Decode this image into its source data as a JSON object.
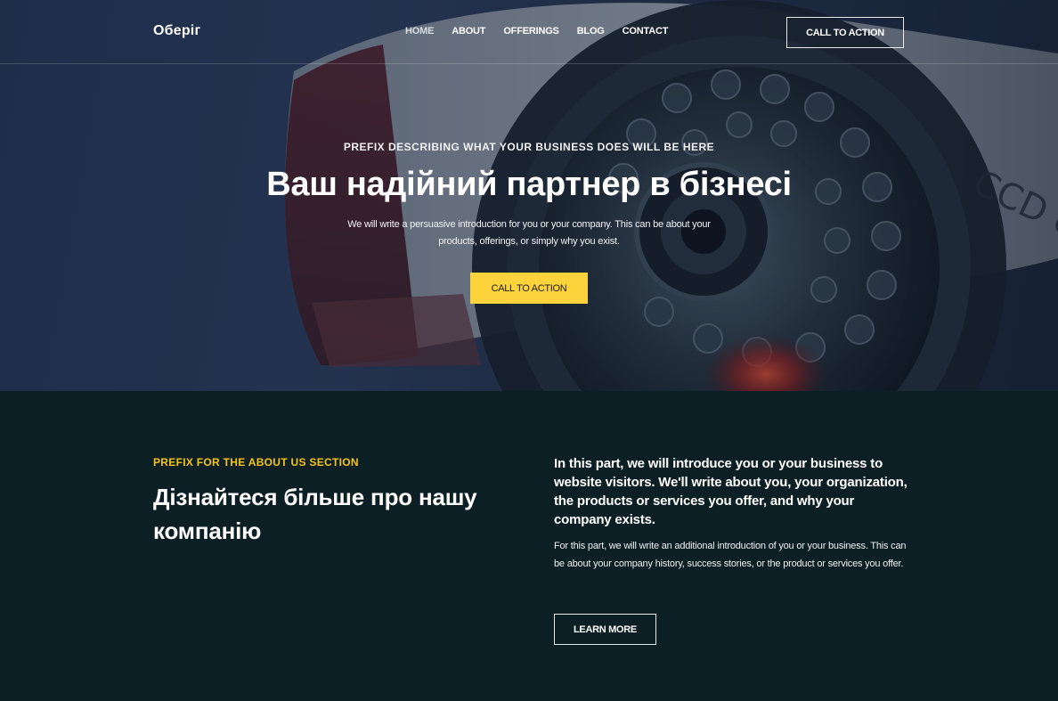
{
  "header": {
    "logo": "Оберіг",
    "nav": [
      "HOME",
      "ABOUT",
      "OFFERINGS",
      "BLOG",
      "CONTACT"
    ],
    "cta_label": "CALL TO ACTION"
  },
  "hero": {
    "prefix": "PREFIX DESCRIBING WHAT YOUR BUSINESS DOES WILL BE HERE",
    "title": "Ваш надійний партнер в бізнесі",
    "intro": "We will write a persuasive introduction for you or your company. This can be about your products, offerings, or simply why you exist.",
    "cta_label": "CALL TO ACTION",
    "background_text": "CCD cam"
  },
  "about": {
    "prefix": "PREFIX FOR THE ABOUT US SECTION",
    "title": "Дізнайтеся більше про нашу компанію",
    "lead": "In this part, we will introduce you or your business to website visitors. We'll write about you, your organization, the products or services you offer, and why your company exists.",
    "body": "For this part, we will write an additional introduction of you or your business. This can be about your company history, success stories, or the product or services you offer.",
    "button_label": "LEARN MORE"
  },
  "colors": {
    "accent_yellow": "#fcd33a",
    "prefix_yellow": "#f5c518",
    "about_background": "#0c1f24",
    "hero_tint": "#2b3f62"
  }
}
